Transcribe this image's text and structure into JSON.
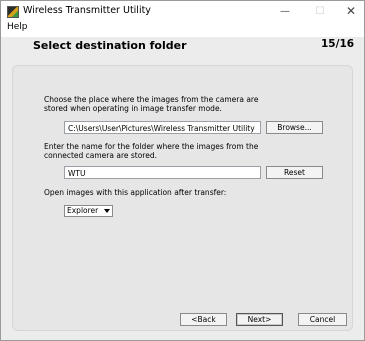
{
  "window": {
    "title": "Wireless Transmitter Utility",
    "icons": {
      "app": "camera-utility-icon",
      "minimize": "minimize-icon",
      "maximize": "maximize-icon",
      "close": "close-icon"
    },
    "minimize_glyph": "—",
    "maximize_glyph": "☐",
    "close_glyph": "✕"
  },
  "menu": {
    "items": [
      {
        "label": "Help"
      }
    ]
  },
  "wizard": {
    "heading": "Select destination folder",
    "step": "15/16",
    "folder_instruction": "Choose the place where the images from the camera are stored when operating in image transfer mode.",
    "folder_path": "C:\\Users\\User\\Pictures\\Wireless Transmitter Utility",
    "browse_label": "Browse...",
    "name_instruction": "Enter the name for the folder where the images from the connected camera are stored.",
    "folder_name": "WTU",
    "reset_label": "Reset",
    "open_with_label": "Open images with this application after transfer:",
    "app_selected": "Explorer",
    "back_label": "<Back",
    "next_label": "Next>",
    "cancel_label": "Cancel"
  }
}
